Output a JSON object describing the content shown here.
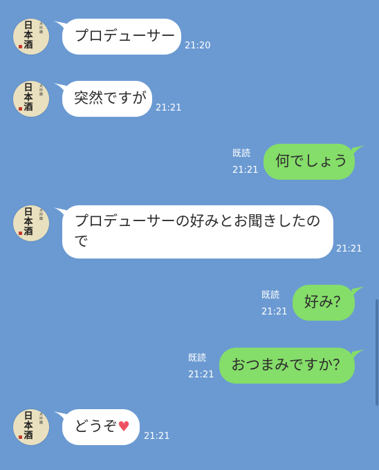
{
  "colors": {
    "background": "#6b9ad2",
    "incoming_bubble": "#ffffff",
    "outgoing_bubble": "#85dd6a",
    "heart": "#ee5262"
  },
  "avatar": {
    "kanji": [
      "日",
      "本",
      "酒"
    ],
    "small_text": "大吟醸"
  },
  "messages": [
    {
      "direction": "in",
      "text": "プロデューサー",
      "time": "21:20"
    },
    {
      "direction": "in",
      "text": "突然ですが",
      "time": "21:21"
    },
    {
      "direction": "out",
      "text": "何でしょう",
      "time": "21:21",
      "read": "既読"
    },
    {
      "direction": "in",
      "text_line1": "プロデューサーの好みとお聞きしたの",
      "text_line2": "で",
      "time": "21:21"
    },
    {
      "direction": "out",
      "text": "好み？",
      "time": "21:21",
      "read": "既読"
    },
    {
      "direction": "out",
      "text": "おつまみですか？",
      "time": "21:21",
      "read": "既読"
    },
    {
      "direction": "in",
      "text": "どうぞ",
      "emoji": "♥",
      "time": "21:21"
    }
  ]
}
